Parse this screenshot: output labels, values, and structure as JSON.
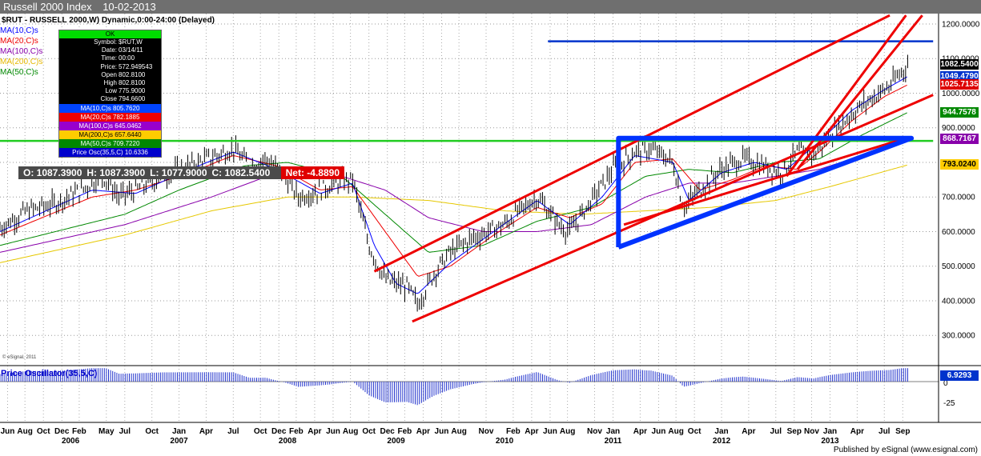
{
  "window": {
    "title": "Russell 2000 Index",
    "date": "10-02-2013"
  },
  "chart_header": "$RUT - RUSSELL 2000,W) Dynamic,0:00-24:00 (Delayed)",
  "legend": [
    {
      "label": "MA(10,C)s",
      "color": "#0000ff"
    },
    {
      "label": "MA(20,C)s",
      "color": "#ee0000"
    },
    {
      "label": "MA(100,C)s",
      "color": "#8800aa"
    },
    {
      "label": "MA(200,C)s",
      "color": "#e6b800"
    },
    {
      "label": "MA(50,C)s",
      "color": "#008800"
    }
  ],
  "info_box": {
    "status": "OK",
    "rows": [
      {
        "k": "Symbol:",
        "v": "$RUT,W"
      },
      {
        "k": "Date:",
        "v": "03/14/11"
      },
      {
        "k": "Time:",
        "v": "00:00"
      },
      {
        "k": "Price:",
        "v": "572.949543"
      },
      {
        "k": "Open",
        "v": "802.8100"
      },
      {
        "k": "High",
        "v": "802.8100"
      },
      {
        "k": "Low",
        "v": "775.9000"
      },
      {
        "k": "Close",
        "v": "794.6600"
      }
    ],
    "ma_rows": [
      {
        "label": "MA(10,C)s 805.7620",
        "bg": "#0044ff",
        "fg": "#ffffff"
      },
      {
        "label": "MA(20,C)s 782.1885",
        "bg": "#ee0000",
        "fg": "#ffffff"
      },
      {
        "label": "MA(100,C)s 645.0462",
        "bg": "#9900cc",
        "fg": "#ffffff"
      },
      {
        "label": "MA(200,C)s 657.6440",
        "bg": "#ffcc00",
        "fg": "#000000"
      },
      {
        "label": "MA(50,C)s 709.7220",
        "bg": "#008800",
        "fg": "#ffffff"
      },
      {
        "label": "Price Osc(35,5,C) 10.6336",
        "bg": "#0000cc",
        "fg": "#ffffff"
      }
    ]
  },
  "ohlc_bar": {
    "o": "O: 1087.3900",
    "h": "H: 1087.3900",
    "l": "L: 1077.9000",
    "c": "C: 1082.5400",
    "net": "Net: -4.8890"
  },
  "price_badges": [
    {
      "value": "1082.5400",
      "y": 1082.54,
      "bg": "#000000",
      "fg": "#ffffff"
    },
    {
      "value": "1049.4790",
      "y": 1049.479,
      "bg": "#0033cc",
      "fg": "#ffffff"
    },
    {
      "value": "1025.7135",
      "y": 1025.7135,
      "bg": "#dd0000",
      "fg": "#ffffff"
    },
    {
      "value": "944.7578",
      "y": 944.7578,
      "bg": "#008800",
      "fg": "#ffffff"
    },
    {
      "value": "868.7167",
      "y": 868.7167,
      "bg": "#8800aa",
      "fg": "#ffffff"
    },
    {
      "value": "793.0240",
      "y": 793.024,
      "bg": "#ffcc00",
      "fg": "#000000"
    }
  ],
  "oscillator": {
    "title": "Price Oscillator(35,5,C)",
    "badge": "6.9293",
    "ticks": [
      "0",
      "-25"
    ]
  },
  "footer": "Published by eSignal (www.esignal.com)",
  "copyright": "© eSignal, 2011",
  "chart_data": {
    "type": "line",
    "y_axis_ticks": [
      "1200.0000",
      "1100.0000",
      "1000.0000",
      "900.0000",
      "800.0000",
      "700.0000",
      "600.0000",
      "500.0000",
      "400.0000",
      "300.0000"
    ],
    "ylim": [
      215,
      1230
    ],
    "x_month_labels": [
      {
        "t": 2005.42,
        "label": "Jun"
      },
      {
        "t": 2005.58,
        "label": "Aug"
      },
      {
        "t": 2005.75,
        "label": "Oct"
      },
      {
        "t": 2005.92,
        "label": "Dec"
      },
      {
        "t": 2006.08,
        "label": "Feb"
      },
      {
        "t": 2006.33,
        "label": "May"
      },
      {
        "t": 2006.5,
        "label": "Jul"
      },
      {
        "t": 2006.75,
        "label": "Oct"
      },
      {
        "t": 2007.0,
        "label": "Jan"
      },
      {
        "t": 2007.25,
        "label": "Apr"
      },
      {
        "t": 2007.5,
        "label": "Jul"
      },
      {
        "t": 2007.75,
        "label": "Oct"
      },
      {
        "t": 2007.92,
        "label": "Dec"
      },
      {
        "t": 2008.08,
        "label": "Feb"
      },
      {
        "t": 2008.25,
        "label": "Apr"
      },
      {
        "t": 2008.42,
        "label": "Jun"
      },
      {
        "t": 2008.58,
        "label": "Aug"
      },
      {
        "t": 2008.75,
        "label": "Oct"
      },
      {
        "t": 2008.92,
        "label": "Dec"
      },
      {
        "t": 2009.08,
        "label": "Feb"
      },
      {
        "t": 2009.25,
        "label": "Apr"
      },
      {
        "t": 2009.42,
        "label": "Jun"
      },
      {
        "t": 2009.58,
        "label": "Aug"
      },
      {
        "t": 2009.83,
        "label": "Nov"
      },
      {
        "t": 2010.08,
        "label": "Feb"
      },
      {
        "t": 2010.25,
        "label": "Apr"
      },
      {
        "t": 2010.42,
        "label": "Jun"
      },
      {
        "t": 2010.58,
        "label": "Aug"
      },
      {
        "t": 2010.83,
        "label": "Nov"
      },
      {
        "t": 2011.0,
        "label": "Jan"
      },
      {
        "t": 2011.25,
        "label": "Apr"
      },
      {
        "t": 2011.42,
        "label": "Jun"
      },
      {
        "t": 2011.58,
        "label": "Aug"
      },
      {
        "t": 2011.75,
        "label": "Oct"
      },
      {
        "t": 2012.0,
        "label": "Jan"
      },
      {
        "t": 2012.25,
        "label": "Apr"
      },
      {
        "t": 2012.5,
        "label": "Jul"
      },
      {
        "t": 2012.67,
        "label": "Sep"
      },
      {
        "t": 2012.83,
        "label": "Nov"
      },
      {
        "t": 2013.0,
        "label": "Jan"
      },
      {
        "t": 2013.25,
        "label": "Apr"
      },
      {
        "t": 2013.5,
        "label": "Jul"
      },
      {
        "t": 2013.67,
        "label": "Sep"
      }
    ],
    "x_year_labels": [
      {
        "t": 2006.0,
        "label": "2006"
      },
      {
        "t": 2007.0,
        "label": "2007"
      },
      {
        "t": 2008.0,
        "label": "2008"
      },
      {
        "t": 2009.0,
        "label": "2009"
      },
      {
        "t": 2010.0,
        "label": "2010"
      },
      {
        "t": 2011.0,
        "label": "2011"
      },
      {
        "t": 2012.0,
        "label": "2012"
      },
      {
        "t": 2013.0,
        "label": "2013"
      }
    ],
    "price": {
      "name": "$RUT,W",
      "x": [
        2005.35,
        2005.6,
        2005.85,
        2006.1,
        2006.3,
        2006.45,
        2006.6,
        2006.85,
        2007.1,
        2007.35,
        2007.5,
        2007.65,
        2007.8,
        2007.95,
        2008.1,
        2008.3,
        2008.45,
        2008.6,
        2008.75,
        2008.9,
        2009.1,
        2009.2,
        2009.35,
        2009.5,
        2009.7,
        2009.85,
        2010.0,
        2010.1,
        2010.3,
        2010.5,
        2010.6,
        2010.8,
        2011.0,
        2011.2,
        2011.35,
        2011.55,
        2011.65,
        2011.8,
        2012.0,
        2012.2,
        2012.4,
        2012.55,
        2012.7,
        2012.85,
        2013.0,
        2013.2,
        2013.4,
        2013.55,
        2013.72
      ],
      "y": [
        610,
        660,
        680,
        720,
        760,
        700,
        720,
        760,
        790,
        820,
        840,
        790,
        810,
        770,
        700,
        720,
        740,
        750,
        560,
        460,
        440,
        390,
        480,
        540,
        580,
        600,
        620,
        650,
        700,
        620,
        600,
        690,
        780,
        830,
        840,
        800,
        670,
        720,
        780,
        810,
        790,
        770,
        830,
        820,
        880,
        940,
        990,
        1020,
        1085
      ]
    },
    "ma10": {
      "x": [
        2005.35,
        2006.2,
        2006.6,
        2007.1,
        2007.5,
        2007.9,
        2008.3,
        2008.6,
        2008.8,
        2009.0,
        2009.2,
        2009.5,
        2009.9,
        2010.3,
        2010.6,
        2010.9,
        2011.2,
        2011.55,
        2011.7,
        2012.0,
        2012.3,
        2012.6,
        2012.9,
        2013.2,
        2013.5,
        2013.72
      ],
      "y": [
        600,
        720,
        710,
        780,
        830,
        780,
        710,
        740,
        560,
        450,
        420,
        510,
        600,
        690,
        620,
        700,
        820,
        800,
        690,
        770,
        800,
        780,
        860,
        950,
        1010,
        1049
      ]
    },
    "ma20": {
      "x": [
        2005.35,
        2006.2,
        2006.6,
        2007.1,
        2007.5,
        2007.9,
        2008.3,
        2008.6,
        2008.9,
        2009.2,
        2009.5,
        2009.9,
        2010.3,
        2010.6,
        2010.9,
        2011.2,
        2011.55,
        2011.8,
        2012.1,
        2012.4,
        2012.7,
        2012.9,
        2013.2,
        2013.5,
        2013.72
      ],
      "y": [
        590,
        700,
        720,
        770,
        820,
        790,
        720,
        730,
        600,
        470,
        500,
        590,
        670,
        640,
        680,
        800,
        810,
        720,
        750,
        790,
        780,
        830,
        920,
        990,
        1025
      ]
    },
    "ma50": {
      "x": [
        2005.35,
        2006.5,
        2007.0,
        2007.6,
        2008.0,
        2008.5,
        2008.9,
        2009.3,
        2009.8,
        2010.3,
        2010.8,
        2011.3,
        2011.7,
        2012.1,
        2012.5,
        2012.9,
        2013.3,
        2013.72
      ],
      "y": [
        560,
        650,
        720,
        790,
        800,
        760,
        650,
        540,
        560,
        630,
        670,
        760,
        780,
        770,
        800,
        810,
        880,
        945
      ]
    },
    "ma100": {
      "x": [
        2005.35,
        2006.5,
        2007.3,
        2007.9,
        2008.4,
        2008.9,
        2009.3,
        2009.8,
        2010.3,
        2010.8,
        2011.3,
        2011.7,
        2012.1,
        2012.5,
        2012.9,
        2013.3,
        2013.72
      ],
      "y": [
        540,
        620,
        700,
        770,
        770,
        720,
        640,
        600,
        600,
        620,
        700,
        740,
        740,
        760,
        780,
        820,
        869
      ]
    },
    "ma200": {
      "x": [
        2005.35,
        2006.5,
        2007.3,
        2008.0,
        2008.6,
        2009.3,
        2010.0,
        2010.7,
        2011.3,
        2011.9,
        2012.5,
        2013.0,
        2013.72
      ],
      "y": [
        510,
        590,
        660,
        700,
        700,
        690,
        660,
        650,
        660,
        670,
        690,
        730,
        793
      ]
    },
    "horizontal_lines": [
      {
        "y": 1150,
        "color": "#0033cc",
        "t_start": 2010.4,
        "t_end": 2013.95
      },
      {
        "y": 862,
        "color": "#22cc22",
        "t_start": 2005.35,
        "t_end": 2013.95
      }
    ],
    "trend_lines": [
      {
        "color": "#ee0000",
        "t1": 2008.8,
        "y1": 485,
        "t2": 2013.55,
        "y2": 1225
      },
      {
        "color": "#ee0000",
        "t1": 2009.15,
        "y1": 340,
        "t2": 2013.95,
        "y2": 995
      },
      {
        "color": "#ee0000",
        "t1": 2012.7,
        "y1": 780,
        "t2": 2013.85,
        "y2": 1225
      },
      {
        "color": "#ee0000",
        "t1": 2012.6,
        "y1": 760,
        "t2": 2013.7,
        "y2": 1225
      },
      {
        "color": "#ee0000",
        "t1": 2011.1,
        "y1": 620,
        "t2": 2013.7,
        "y2": 870
      }
    ],
    "triangle": {
      "color": "#0033ff",
      "points": [
        [
          2011.05,
          870
        ],
        [
          2013.75,
          870
        ],
        [
          2011.05,
          555
        ],
        [
          2013.75,
          872
        ]
      ]
    }
  }
}
